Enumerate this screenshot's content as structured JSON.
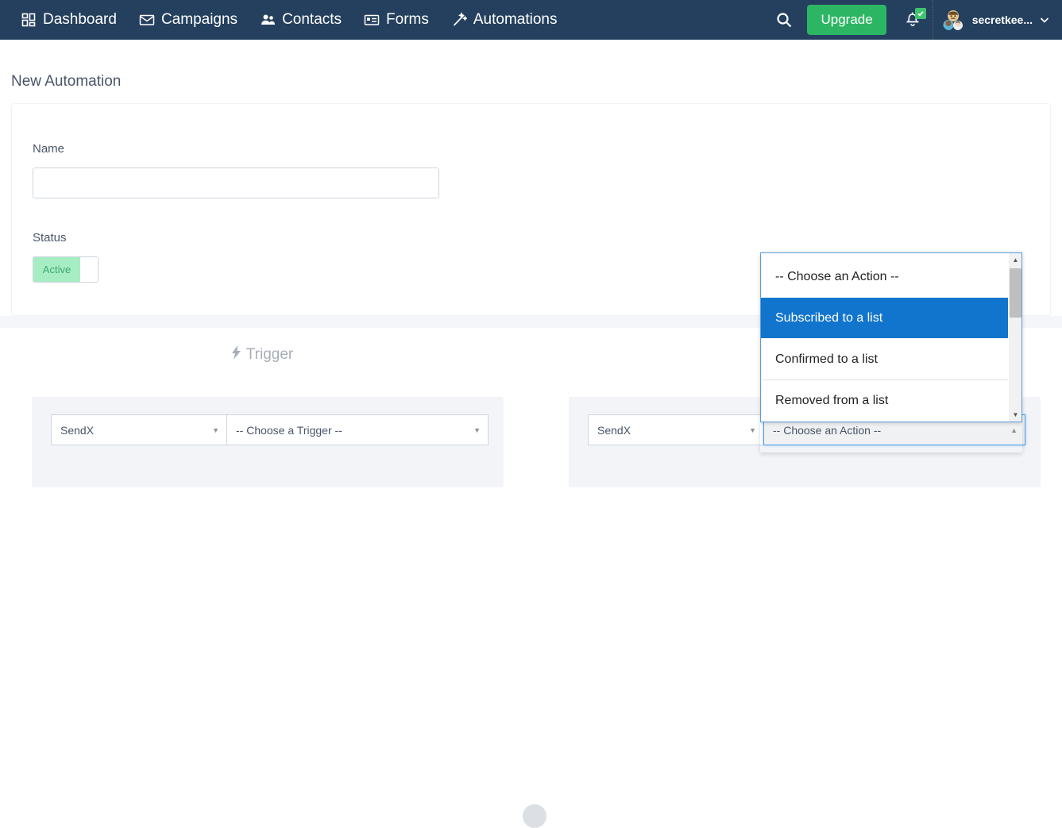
{
  "navbar": {
    "items": [
      {
        "label": "Dashboard",
        "icon": "grid-icon"
      },
      {
        "label": "Campaigns",
        "icon": "envelope-icon"
      },
      {
        "label": "Contacts",
        "icon": "people-icon"
      },
      {
        "label": "Forms",
        "icon": "form-icon"
      },
      {
        "label": "Automations",
        "icon": "magic-wand-icon"
      }
    ],
    "search_icon": "search-icon",
    "upgrade_label": "Upgrade",
    "bell_icon": "bell-icon",
    "bell_badge_icon": "check-icon",
    "user_name": "secretkee...",
    "user_caret": "chevron-down-icon",
    "background_color": "#24405e",
    "upgrade_color": "#2cb664",
    "badge_color": "#3ec46d"
  },
  "page": {
    "title": "New Automation"
  },
  "form": {
    "name_label": "Name",
    "name_value": "",
    "name_placeholder": "",
    "status_label": "Status",
    "status_toggle_label": "Active",
    "status_toggle_on": true,
    "toggle_on_color": "#a6edc4",
    "toggle_text_color": "#3fa76c"
  },
  "trigger_section": {
    "heading": "Trigger",
    "heading_icon": "lightning-bolt-icon",
    "trigger_node": {
      "source_select_value": "SendX",
      "event_select_value": "-- Choose a Trigger --",
      "caret_icon": "caret-down-icon"
    },
    "action_node": {
      "source_select_value": "SendX",
      "action_select_value": "-- Choose an Action --",
      "caret_icon": "caret-up-icon"
    }
  },
  "action_dropdown": {
    "open": true,
    "highlight_color": "#1275cd",
    "border_color": "#5a9fe0",
    "options": [
      {
        "label": "-- Choose an Action --",
        "selected": false
      },
      {
        "label": "Subscribed to a list",
        "selected": true
      },
      {
        "label": "Confirmed to a list",
        "selected": false
      },
      {
        "label": "Removed from a list",
        "selected": false
      }
    ],
    "scroll_up_icon": "triangle-up-icon",
    "scroll_down_icon": "triangle-down-icon"
  }
}
